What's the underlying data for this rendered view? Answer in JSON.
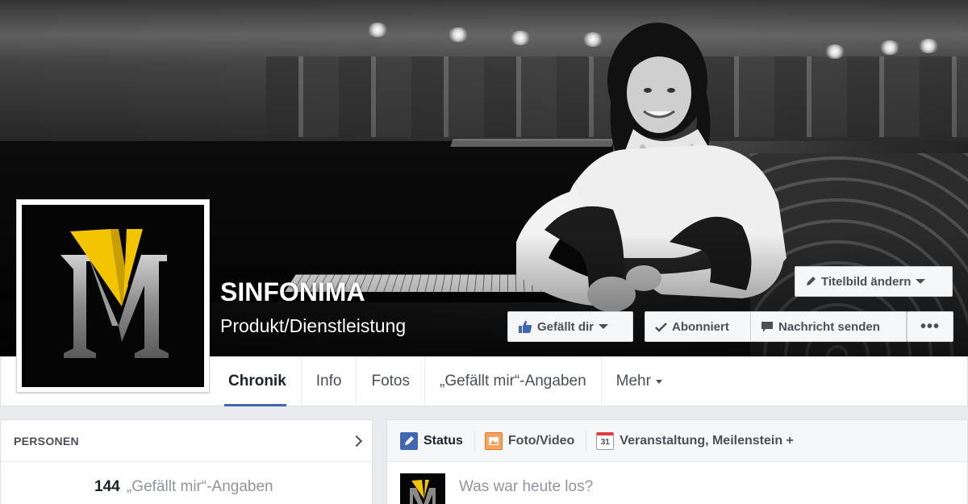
{
  "page": {
    "name": "SINFONIMA",
    "category": "Produkt/Dienstleistung"
  },
  "cover_actions": {
    "change_cover": "Titelbild ändern",
    "like": "Gefällt dir",
    "subscribed": "Abonniert",
    "message": "Nachricht senden",
    "more": "•••"
  },
  "tabs": [
    {
      "label": "Chronik",
      "active": true
    },
    {
      "label": "Info"
    },
    {
      "label": "Fotos"
    },
    {
      "label": "„Gefällt mir“-Angaben"
    },
    {
      "label": "Mehr"
    }
  ],
  "people": {
    "title": "PERSONEN",
    "likes_count": "144",
    "likes_label": "„Gefällt mir“-Angaben"
  },
  "composer": {
    "tabs": [
      "Status",
      "Foto/Video",
      "Veranstaltung, Meilenstein +"
    ],
    "calendar_day": "31",
    "placeholder": "Was war heute los?"
  },
  "colors": {
    "accent": "#4267b2",
    "logo_yellow": "#f2c500",
    "logo_grey": "#8a8a8a"
  }
}
